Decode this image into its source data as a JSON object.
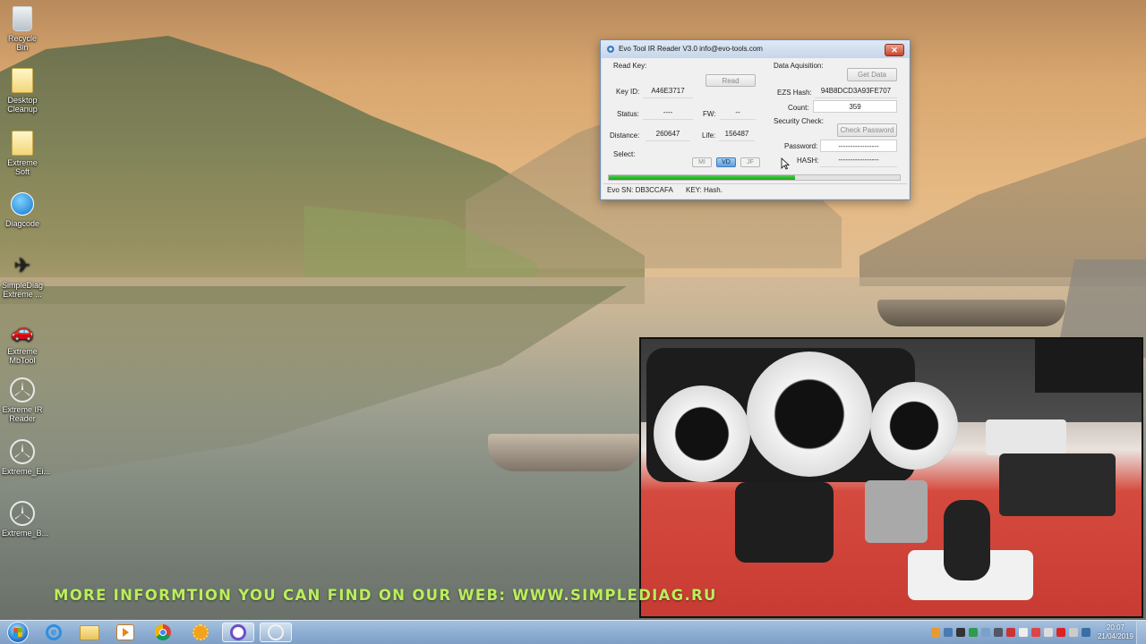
{
  "desktop": {
    "icons": [
      {
        "label": "Recycle Bin"
      },
      {
        "label": "Desktop Cleanup"
      },
      {
        "label": "Extreme Soft"
      },
      {
        "label": "Diagcode"
      },
      {
        "label": "SimpleDiag Extreme ..."
      },
      {
        "label": "Extreme MbTool"
      },
      {
        "label": "Extreme IR Reader"
      },
      {
        "label": "Extreme_Ei..."
      },
      {
        "label": "Extreme_B..."
      }
    ]
  },
  "dialog": {
    "title": "Evo Tool IR Reader V3.0   info@evo-tools.com",
    "close": "✕",
    "read_key": {
      "section": "Read Key:",
      "read_button": "Read",
      "key_id_label": "Key ID:",
      "key_id_value": "A46E3717",
      "status_label": "Status:",
      "status_value": "----",
      "fw_label": "FW:",
      "fw_value": "--",
      "distance_label": "Distance:",
      "distance_value": "260647",
      "life_label": "Life:",
      "life_value": "156487"
    },
    "select": {
      "label": "Select:",
      "options": [
        "MI",
        "VD",
        "JF"
      ],
      "selected": "VD"
    },
    "data_acquisition": {
      "section": "Data Aquisition:",
      "get_data_button": "Get Data",
      "ezs_hash_label": "EZS Hash:",
      "ezs_hash_value": "94B8DCD3A93FE707",
      "count_label": "Count:",
      "count_value": "359"
    },
    "security_check": {
      "section": "Security Check:",
      "check_password_button": "Check Password",
      "password_label": "Password:",
      "password_value": "-----------------",
      "hash_label": "HASH:",
      "hash_value": "-----------------"
    },
    "progress": 0.64,
    "statusbar": {
      "evo_sn": "Evo SN: DB3CCAFA",
      "key": "KEY: Hash."
    }
  },
  "banner": "MORE INFORMTION YOU CAN FIND ON OUR WEB: WWW.SIMPLEDIAG.RU",
  "taskbar": {
    "clock_time": "20:07",
    "clock_date": "21/04/2019"
  },
  "colors": {
    "banner": "#b9ef5a",
    "progress": "#1ea01e",
    "selected_segment": "#5d9fd9"
  }
}
